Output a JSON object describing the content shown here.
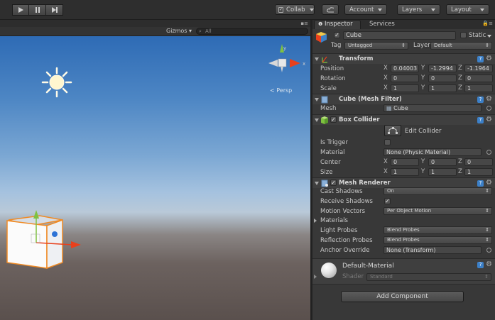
{
  "toolbar": {
    "collab_label": "Collab",
    "account_label": "Account",
    "layers_label": "Layers",
    "layout_label": "Layout"
  },
  "scene": {
    "gizmos_label": "Gizmos",
    "search_placeholder": "All",
    "persp_label": "Persp",
    "axis_x": "x",
    "axis_y": "y"
  },
  "inspector": {
    "tab_inspector": "Inspector",
    "tab_services": "Services",
    "object": {
      "name": "Cube",
      "static_label": "Static",
      "tag_label": "Tag",
      "tag_value": "Untagged",
      "layer_label": "Layer",
      "layer_value": "Default"
    },
    "transform": {
      "title": "Transform",
      "position_label": "Position",
      "rotation_label": "Rotation",
      "scale_label": "Scale",
      "x": "X",
      "y": "Y",
      "z": "Z",
      "position": [
        "0.04003",
        "-1.2994",
        "-1.1964"
      ],
      "rotation": [
        "0",
        "0",
        "0"
      ],
      "scale": [
        "1",
        "1",
        "1"
      ]
    },
    "mesh_filter": {
      "title": "Cube (Mesh Filter)",
      "mesh_label": "Mesh",
      "mesh_value": "Cube"
    },
    "box_collider": {
      "title": "Box Collider",
      "edit_label": "Edit Collider",
      "is_trigger_label": "Is Trigger",
      "material_label": "Material",
      "material_value": "None (Physic Material)",
      "center_label": "Center",
      "size_label": "Size",
      "center": [
        "0",
        "0",
        "0"
      ],
      "size": [
        "1",
        "1",
        "1"
      ]
    },
    "mesh_renderer": {
      "title": "Mesh Renderer",
      "cast_shadows_label": "Cast Shadows",
      "cast_shadows_value": "On",
      "receive_shadows_label": "Receive Shadows",
      "motion_vectors_label": "Motion Vectors",
      "motion_vectors_value": "Per Object Motion",
      "materials_label": "Materials",
      "light_probes_label": "Light Probes",
      "light_probes_value": "Blend Probes",
      "reflection_probes_label": "Reflection Probes",
      "reflection_probes_value": "Blend Probes",
      "anchor_override_label": "Anchor Override",
      "anchor_override_value": "None (Transform)"
    },
    "material": {
      "name": "Default-Material",
      "shader_label": "Shader",
      "shader_value": "Standard"
    },
    "add_component_label": "Add Component"
  },
  "colors": {
    "accent_blue": "#3c80c8",
    "axis_red": "#e8401c",
    "axis_green": "#7fc240",
    "selection_orange": "#f08a24"
  }
}
